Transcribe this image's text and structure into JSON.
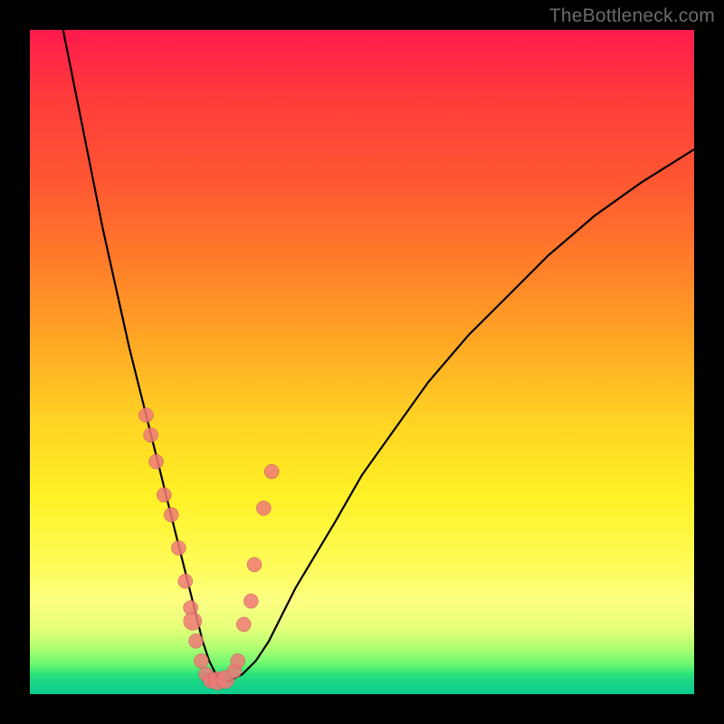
{
  "watermark": "TheBottleneck.com",
  "colors": {
    "background": "#000000",
    "curve": "#000000",
    "dot_fill": "#ee7a78",
    "dot_stroke": "#c05a58"
  },
  "chart_data": {
    "type": "line",
    "title": "",
    "xlabel": "",
    "ylabel": "",
    "xlim": [
      0,
      100
    ],
    "ylim": [
      0,
      100
    ],
    "series": [
      {
        "name": "bottleneck-curve",
        "x": [
          5,
          7,
          9,
          11,
          13,
          15,
          17,
          19,
          21,
          23,
          24,
          25,
          26,
          27,
          28,
          29,
          30,
          32,
          34,
          36,
          38,
          40,
          43,
          46,
          50,
          55,
          60,
          66,
          72,
          78,
          85,
          92,
          100
        ],
        "y": [
          100,
          90,
          80,
          70,
          61,
          52,
          44,
          36,
          28,
          20,
          16,
          12,
          8,
          5,
          3,
          2,
          2,
          3,
          5,
          8,
          12,
          16,
          21,
          26,
          33,
          40,
          47,
          54,
          60,
          66,
          72,
          77,
          82
        ]
      }
    ],
    "scatter": [
      {
        "name": "marker-dots",
        "x": [
          17.5,
          18.2,
          19.0,
          20.2,
          21.3,
          22.4,
          23.4,
          24.2,
          24.5,
          25.0,
          25.8,
          26.5,
          27.2,
          28.2,
          29.4,
          30.8,
          31.3,
          32.2,
          33.3,
          33.8,
          35.2,
          36.4
        ],
        "y": [
          42.0,
          39.0,
          35.0,
          30.0,
          27.0,
          22.0,
          17.0,
          13.0,
          11.0,
          8.0,
          5.0,
          3.0,
          2.0,
          2.0,
          2.2,
          3.5,
          5.0,
          10.5,
          14.0,
          19.5,
          28.0,
          33.5
        ],
        "r": [
          8,
          8,
          8,
          8,
          8,
          8,
          8,
          8,
          10,
          8,
          8,
          8,
          8,
          10,
          10,
          8,
          8,
          8,
          8,
          8,
          8,
          8
        ]
      }
    ]
  }
}
